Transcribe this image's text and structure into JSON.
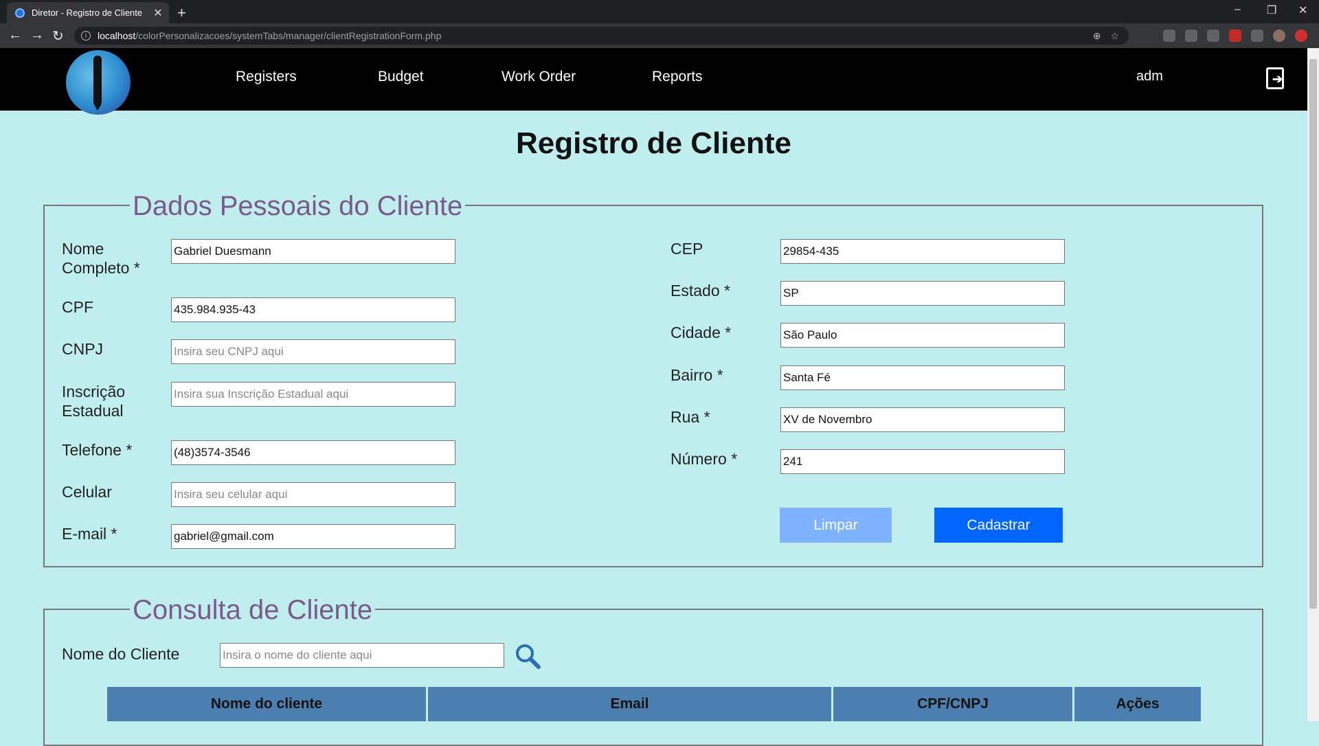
{
  "browser": {
    "tab_title": "Diretor - Registro de Cliente",
    "tab_close": "✕",
    "new_tab": "+",
    "url_host": "localhost",
    "url_path": "/colorPersonalizacoes/systemTabs/manager/clientRegistrationForm.php",
    "window_controls": [
      "–",
      "❐",
      "✕"
    ]
  },
  "nav": {
    "items": [
      "Registers",
      "Budget",
      "Work Order",
      "Reports"
    ],
    "user": "adm"
  },
  "page": {
    "title": "Registro de Cliente"
  },
  "personal": {
    "legend": "Dados Pessoais do Cliente",
    "fields": [
      {
        "label": "Nome Completo *",
        "value": "Gabriel Duesmann",
        "placeholder": ""
      },
      {
        "label": "CPF",
        "value": "435.984.935-43",
        "placeholder": ""
      },
      {
        "label": "CNPJ",
        "value": "",
        "placeholder": "Insira seu CNPJ aqui"
      },
      {
        "label": "Inscrição Estadual",
        "value": "",
        "placeholder": "Insira sua Inscrição Estadual aqui"
      },
      {
        "label": "Telefone *",
        "value": "(48)3574-3546",
        "placeholder": ""
      },
      {
        "label": "Celular",
        "value": "",
        "placeholder": "Insira seu celular aqui"
      },
      {
        "label": "E-mail *",
        "value": "gabriel@gmail.com",
        "placeholder": ""
      }
    ],
    "address": [
      {
        "label": "CEP",
        "value": "29854-435"
      },
      {
        "label": "Estado *",
        "value": "SP"
      },
      {
        "label": "Cidade *",
        "value": "São Paulo"
      },
      {
        "label": "Bairro *",
        "value": "Santa Fé"
      },
      {
        "label": "Rua *",
        "value": "XV de Novembro"
      },
      {
        "label": "Número *",
        "value": "241"
      }
    ],
    "clear_button": "Limpar",
    "submit_button": "Cadastrar"
  },
  "query": {
    "legend": "Consulta de Cliente",
    "name_label": "Nome do Cliente",
    "name_placeholder": "Insira o nome do cliente aqui",
    "columns": [
      "Nome do cliente",
      "Email",
      "CPF/CNPJ",
      "Ações"
    ]
  },
  "colors": {
    "background": "#c0eeee",
    "header": "#000000",
    "legend": "#7a5a8a",
    "clear_button": "#80b3ff",
    "submit_button": "#0066ff",
    "table_header": "#4a7fb0"
  }
}
